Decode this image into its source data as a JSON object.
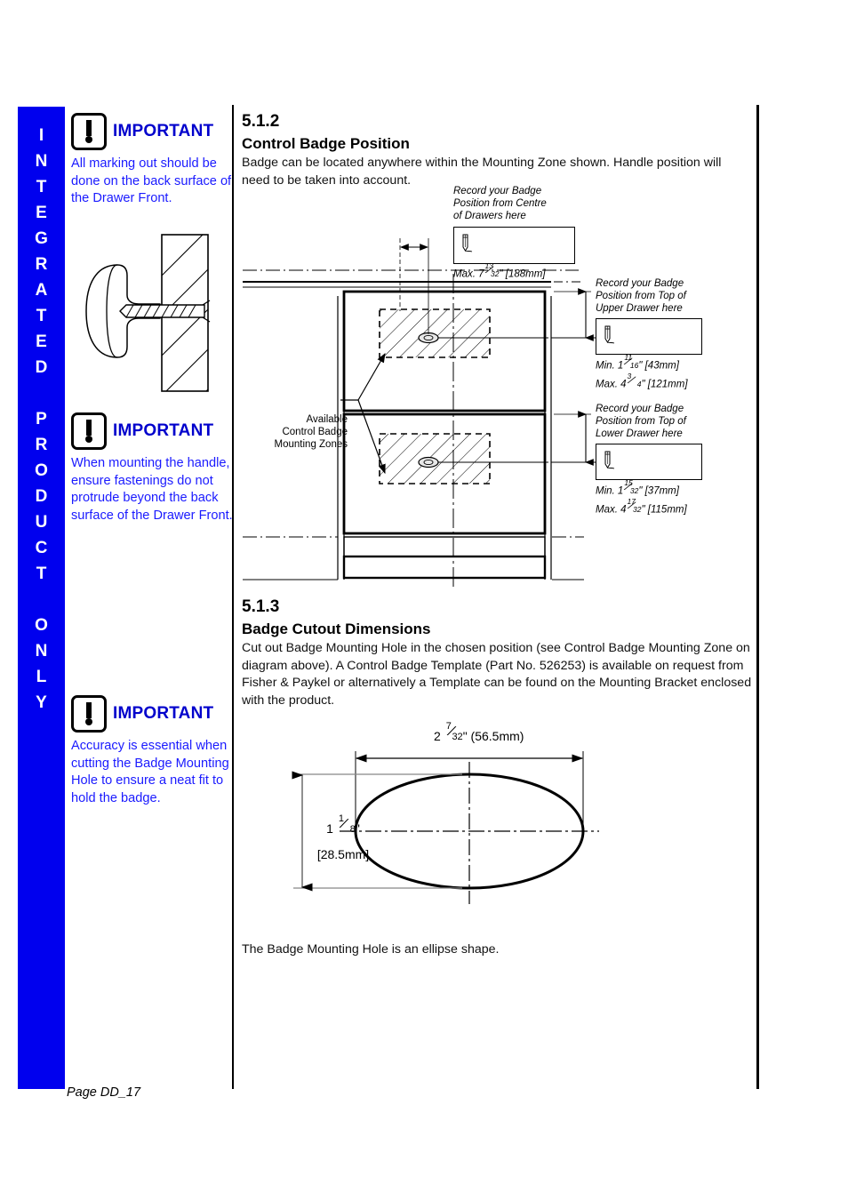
{
  "sidebar": {
    "text": "INTEGRATED PRODUCT ONLY",
    "color": "#0000ee",
    "letters": [
      "I",
      "N",
      "T",
      "E",
      "G",
      "R",
      "A",
      "T",
      "E",
      "D",
      "",
      "P",
      "R",
      "O",
      "D",
      "U",
      "C",
      "T",
      "",
      "O",
      "N",
      "L",
      "Y"
    ]
  },
  "important_blocks": [
    {
      "label": "IMPORTANT",
      "body": "All marking out should be done on the back surface of the Drawer Front."
    },
    {
      "label": "IMPORTANT",
      "body": "When mounting the handle, ensure fastenings do not protrude beyond the back surface of the Drawer Front."
    },
    {
      "label": "IMPORTANT",
      "body": "Accuracy is essential when cutting the Badge Mounting Hole to ensure a neat fit to hold the badge."
    }
  ],
  "sections": [
    {
      "number": "5.1.2",
      "title": "Control Badge Position",
      "body": "Badge can be located anywhere within the Mounting Zone shown. Handle position will need to be taken into account."
    },
    {
      "number": "5.1.3",
      "title": "Badge Cutout Dimensions",
      "body": "Cut out Badge Mounting Hole in the chosen position (see Control Badge Mounting Zone on diagram above). A Control Badge Template (Part No. 526253) is available on request from Fisher & Paykel or alternatively a Template can be found on the Mounting Bracket enclosed with the product."
    }
  ],
  "drawer_diagram": {
    "centre_note": "Record your Badge\nPosition from Centre\nof Drawers here",
    "centre_note_l1": "Record your Badge",
    "centre_note_l2": "Position from Centre",
    "centre_note_l3": "of Drawers here",
    "centre_max_prefix": "Max. 7",
    "centre_max_num": "13",
    "centre_max_den": "32",
    "centre_max_suffix": "\" [188mm]",
    "upper_note_l1": "Record your Badge",
    "upper_note_l2": "Position from Top of",
    "upper_note_l3": "Upper Drawer here",
    "upper_min_prefix": "Min. 1",
    "upper_min_num": "11",
    "upper_min_den": "16",
    "upper_min_suffix": "\" [43mm]",
    "upper_max_prefix": "Max. 4",
    "upper_max_num": "3",
    "upper_max_den": "4",
    "upper_max_suffix": "\" [121mm]",
    "lower_note_l1": "Record your Badge",
    "lower_note_l2": "Position from Top of",
    "lower_note_l3": "Lower Drawer here",
    "lower_min_prefix": "Min. 1",
    "lower_min_num": "15",
    "lower_min_den": "32",
    "lower_min_suffix": "\" [37mm]",
    "lower_max_prefix": "Max. 4",
    "lower_max_num": "17",
    "lower_max_den": "32",
    "lower_max_suffix": "\" [115mm]",
    "zone_label_l1": "Available",
    "zone_label_l2": "Control Badge",
    "zone_label_l3": "Mounting Zones"
  },
  "ellipse_diagram": {
    "width_prefix": "2",
    "width_num": "7",
    "width_den": "32",
    "width_suffix": "\" (56.5mm)",
    "height_prefix": "1",
    "height_num": "1",
    "height_den": "8",
    "height_suffix": "\"",
    "height_mm": "[28.5mm]",
    "caption": "The Badge Mounting Hole is an ellipse shape."
  },
  "footer": {
    "page_label": "Page DD_17"
  }
}
